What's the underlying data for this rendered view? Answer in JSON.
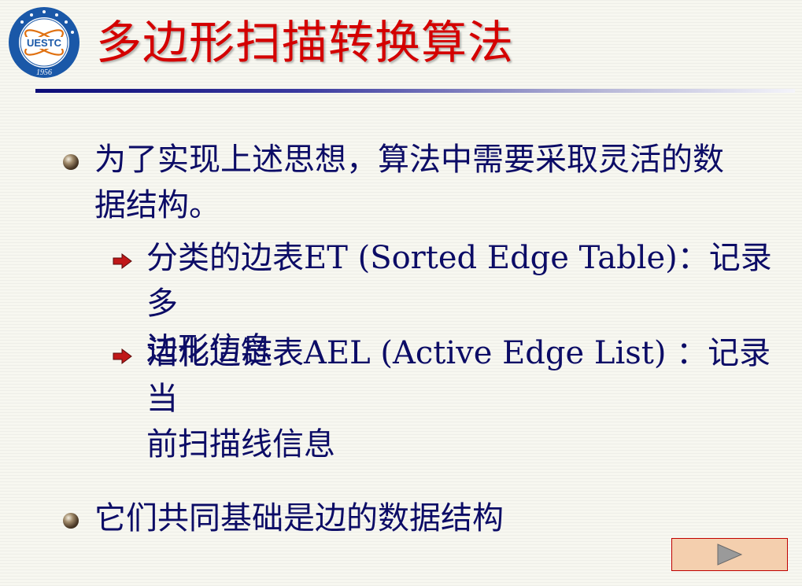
{
  "slide": {
    "title": "多边形扫描转换算法",
    "bullets": [
      {
        "text": "为了实现上述思想，算法中需要采取灵活的数\n据结构。",
        "sub": [
          {
            "text": "分类的边表ET (Sorted Edge Table)：记录多\n边形信息"
          },
          {
            "text": "活化边链表AEL (Active Edge List) ：记录当\n前扫描线信息"
          }
        ]
      },
      {
        "text": "它们共同基础是边的数据结构"
      }
    ]
  },
  "logo": {
    "center_text": "UESTC",
    "year": "1956",
    "ring_color": "#1a58a8"
  },
  "nav": {
    "icon": "play-next-icon"
  },
  "colors": {
    "title": "#d40000",
    "text": "#0c0c66",
    "sub_arrow": "#c01818",
    "nav_border": "#c00000",
    "nav_fill": "#f4cfae"
  }
}
